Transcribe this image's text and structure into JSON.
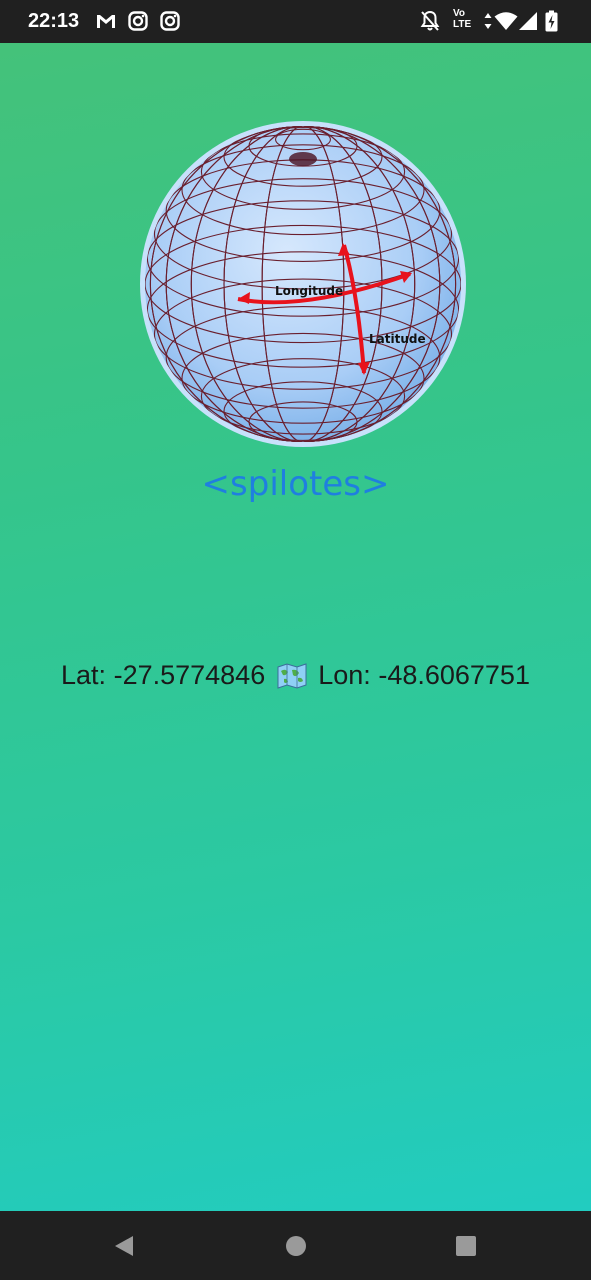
{
  "status_bar": {
    "time": "22:13",
    "left_icons": [
      "gmail-icon",
      "instagram-icon",
      "instagram-icon"
    ],
    "right_icons": [
      "bell-off-icon",
      "volte-icon",
      "data-arrows-icon",
      "wifi-icon",
      "cell-signal-icon",
      "battery-charging-icon"
    ],
    "volte_top": "Vo",
    "volte_bottom": "LTE"
  },
  "globe": {
    "longitude_label": "Longitude",
    "latitude_label": "Latitude",
    "arrow_color": "#e8121c",
    "grid_color": "#6a1f2e",
    "sphere_color": "#a9cdf6"
  },
  "brand": {
    "text": "<spilotes>",
    "color": "#1f7fe0"
  },
  "location": {
    "lat_label": "Lat:",
    "lat_value": "-27.5774846",
    "lon_label": "Lon:",
    "lon_value": "-48.6067751",
    "separator_icon": "world-map-icon"
  },
  "nav_bar": {
    "buttons": [
      "back-icon",
      "home-icon",
      "recents-icon"
    ]
  },
  "colors": {
    "gradient_top": "#44c27a",
    "gradient_bottom": "#22ccc0",
    "bars": "#202020"
  }
}
